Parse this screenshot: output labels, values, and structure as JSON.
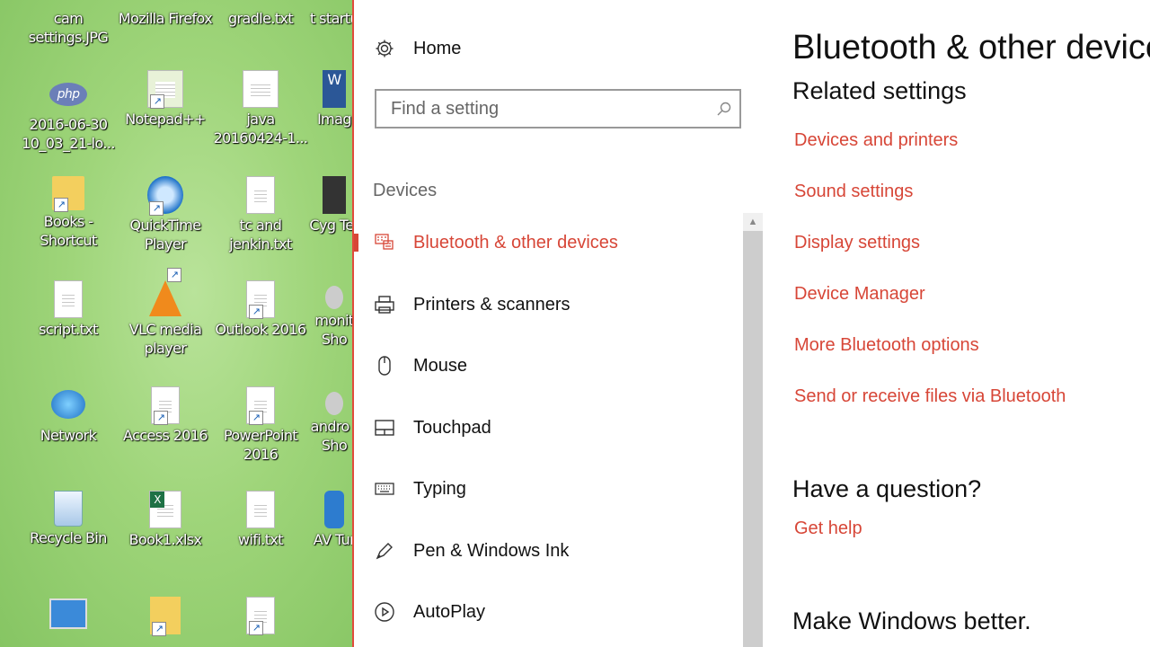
{
  "desktop": {
    "icons": [
      {
        "label": "cam settings.JPG"
      },
      {
        "label": "Mozilla Firefox"
      },
      {
        "label": "gradle.txt"
      },
      {
        "label": "t startu"
      },
      {
        "label": "2016-06-30 10_03_21-lo..."
      },
      {
        "label": "Notepad++"
      },
      {
        "label": "java 20160424-1..."
      },
      {
        "label": "Imag"
      },
      {
        "label": "Books - Shortcut"
      },
      {
        "label": "QuickTime Player"
      },
      {
        "label": "tc and jenkin.txt"
      },
      {
        "label": "Cyg Ter"
      },
      {
        "label": "script.txt"
      },
      {
        "label": "VLC media player"
      },
      {
        "label": "Outlook 2016"
      },
      {
        "label": "monit Sho"
      },
      {
        "label": "Network"
      },
      {
        "label": "Access 2016"
      },
      {
        "label": "PowerPoint 2016"
      },
      {
        "label": "andro - Sho"
      },
      {
        "label": "Recycle Bin"
      },
      {
        "label": "Book1.xlsx"
      },
      {
        "label": "wifi.txt"
      },
      {
        "label": "AV Tur"
      }
    ]
  },
  "settings": {
    "home_label": "Home",
    "search_placeholder": "Find a setting",
    "section_label": "Devices",
    "nav": [
      {
        "label": "Bluetooth & other devices",
        "icon": "bluetooth-devices-icon",
        "active": true
      },
      {
        "label": "Printers & scanners",
        "icon": "printer-icon"
      },
      {
        "label": "Mouse",
        "icon": "mouse-icon"
      },
      {
        "label": "Touchpad",
        "icon": "touchpad-icon"
      },
      {
        "label": "Typing",
        "icon": "keyboard-icon"
      },
      {
        "label": "Pen & Windows Ink",
        "icon": "pen-icon"
      },
      {
        "label": "AutoPlay",
        "icon": "autoplay-icon"
      }
    ],
    "page_title": "Bluetooth & other devices",
    "related_heading": "Related settings",
    "related_links": [
      "Devices and printers",
      "Sound settings",
      "Display settings",
      "Device Manager",
      "More Bluetooth options",
      "Send or receive files via Bluetooth"
    ],
    "question_heading": "Have a question?",
    "get_help": "Get help",
    "better_heading": "Make Windows better."
  },
  "colors": {
    "accent": "#d74637",
    "desktop_green": "#9fd57a"
  }
}
